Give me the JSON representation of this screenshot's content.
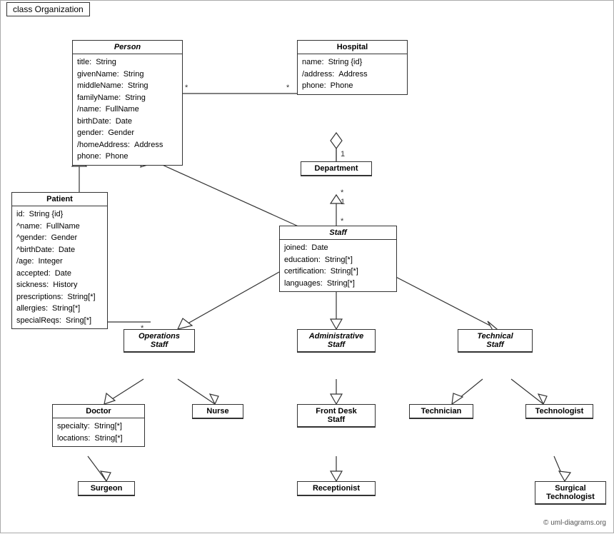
{
  "title": "class Organization",
  "copyright": "© uml-diagrams.org",
  "classes": {
    "person": {
      "name": "Person",
      "italic": true,
      "attrs": [
        [
          "title:",
          "String"
        ],
        [
          "givenName:",
          "String"
        ],
        [
          "middleName:",
          "String"
        ],
        [
          "familyName:",
          "String"
        ],
        [
          "/name:",
          "FullName"
        ],
        [
          "birthDate:",
          "Date"
        ],
        [
          "gender:",
          "Gender"
        ],
        [
          "/homeAddress:",
          "Address"
        ],
        [
          "phone:",
          "Phone"
        ]
      ]
    },
    "hospital": {
      "name": "Hospital",
      "italic": false,
      "attrs": [
        [
          "name:",
          "String {id}"
        ],
        [
          "/address:",
          "Address"
        ],
        [
          "phone:",
          "Phone"
        ]
      ]
    },
    "department": {
      "name": "Department",
      "italic": false,
      "attrs": []
    },
    "staff": {
      "name": "Staff",
      "italic": true,
      "attrs": [
        [
          "joined:",
          "Date"
        ],
        [
          "education:",
          "String[*]"
        ],
        [
          "certification:",
          "String[*]"
        ],
        [
          "languages:",
          "String[*]"
        ]
      ]
    },
    "patient": {
      "name": "Patient",
      "italic": false,
      "attrs": [
        [
          "id:",
          "String {id}"
        ],
        [
          "^name:",
          "FullName"
        ],
        [
          "^gender:",
          "Gender"
        ],
        [
          "^birthDate:",
          "Date"
        ],
        [
          "/age:",
          "Integer"
        ],
        [
          "accepted:",
          "Date"
        ],
        [
          "sickness:",
          "History"
        ],
        [
          "prescriptions:",
          "String[*]"
        ],
        [
          "allergies:",
          "String[*]"
        ],
        [
          "specialReqs:",
          "Sring[*]"
        ]
      ]
    },
    "operations_staff": {
      "name": "Operations\nStaff",
      "italic": true,
      "attrs": []
    },
    "administrative_staff": {
      "name": "Administrative\nStaff",
      "italic": true,
      "attrs": []
    },
    "technical_staff": {
      "name": "Technical\nStaff",
      "italic": true,
      "attrs": []
    },
    "doctor": {
      "name": "Doctor",
      "italic": false,
      "attrs": [
        [
          "specialty:",
          "String[*]"
        ],
        [
          "locations:",
          "String[*]"
        ]
      ]
    },
    "nurse": {
      "name": "Nurse",
      "italic": false,
      "attrs": []
    },
    "front_desk_staff": {
      "name": "Front Desk\nStaff",
      "italic": false,
      "attrs": []
    },
    "technician": {
      "name": "Technician",
      "italic": false,
      "attrs": []
    },
    "technologist": {
      "name": "Technologist",
      "italic": false,
      "attrs": []
    },
    "surgeon": {
      "name": "Surgeon",
      "italic": false,
      "attrs": []
    },
    "receptionist": {
      "name": "Receptionist",
      "italic": false,
      "attrs": []
    },
    "surgical_technologist": {
      "name": "Surgical\nTechnologist",
      "italic": false,
      "attrs": []
    }
  }
}
